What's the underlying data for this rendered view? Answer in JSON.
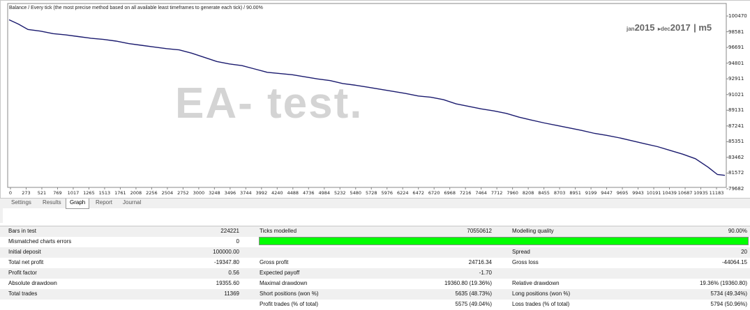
{
  "chart": {
    "title": "Balance / Every tick (the most precise method based on all available least timeframes to generate each tick) / 90.00%",
    "watermark": "EA-      test.",
    "period": {
      "from_month": "jan",
      "from_year": "2015",
      "to_month": "dec",
      "to_year": "2017",
      "tf": "m5"
    },
    "line_color": "#1a1a6e"
  },
  "chart_data": {
    "type": "line",
    "ylabel": "",
    "xlabel": "",
    "y_ticks": [
      "100470",
      "98581",
      "96691",
      "94801",
      "92911",
      "91021",
      "89131",
      "87241",
      "85351",
      "83462",
      "81572",
      "79682"
    ],
    "ylim": [
      79682,
      100470
    ],
    "x_ticks": [
      "0",
      "273",
      "521",
      "769",
      "1017",
      "1265",
      "1513",
      "1761",
      "2008",
      "2256",
      "2504",
      "2752",
      "3000",
      "3248",
      "3496",
      "3744",
      "3992",
      "4240",
      "4488",
      "4736",
      "4984",
      "5232",
      "5480",
      "5728",
      "5976",
      "6224",
      "6472",
      "6720",
      "6968",
      "7216",
      "7464",
      "7712",
      "7960",
      "8208",
      "8455",
      "8703",
      "8951",
      "9199",
      "9447",
      "9695",
      "9943",
      "10191",
      "10439",
      "10687",
      "10935",
      "11183"
    ],
    "xlim": [
      0,
      11369
    ],
    "series": [
      {
        "x": [
          0,
          150,
          300,
          500,
          700,
          900,
          1100,
          1300,
          1500,
          1700,
          1900,
          2100,
          2300,
          2500,
          2700,
          2900,
          3100,
          3300,
          3500,
          3700,
          3900,
          4100,
          4300,
          4500,
          4700,
          4900,
          5100,
          5300,
          5500,
          5700,
          5900,
          6100,
          6300,
          6500,
          6700,
          6900,
          7100,
          7300,
          7500,
          7700,
          7900,
          8100,
          8300,
          8500,
          8700,
          8900,
          9100,
          9300,
          9500,
          9700,
          9900,
          10100,
          10300,
          10500,
          10700,
          10900,
          11100,
          11250,
          11369
        ],
        "y": [
          100020,
          99500,
          98850,
          98650,
          98350,
          98200,
          98000,
          97800,
          97650,
          97450,
          97150,
          96950,
          96750,
          96550,
          96400,
          96000,
          95500,
          95000,
          94700,
          94500,
          94100,
          93700,
          93550,
          93400,
          93150,
          92900,
          92700,
          92350,
          92150,
          91900,
          91650,
          91400,
          91150,
          90850,
          90700,
          90400,
          89900,
          89600,
          89300,
          89050,
          88750,
          88300,
          87950,
          87600,
          87300,
          87000,
          86700,
          86350,
          86100,
          85800,
          85450,
          85100,
          84750,
          84300,
          83850,
          83300,
          82300,
          81400,
          81300
        ]
      }
    ]
  },
  "tabs": [
    {
      "label": "Settings",
      "active": false
    },
    {
      "label": "Results",
      "active": false
    },
    {
      "label": "Graph",
      "active": true
    },
    {
      "label": "Report",
      "active": false
    },
    {
      "label": "Journal",
      "active": false
    }
  ],
  "report": {
    "bars_label": "Bars in test",
    "bars_value": "224221",
    "ticks_label": "Ticks modelled",
    "ticks_value": "70550612",
    "quality_label": "Modelling quality",
    "quality_value": "90.00%",
    "mismatch_label": "Mismatched charts errors",
    "mismatch_value": "0",
    "quality_bar_color": "#00ff00",
    "deposit_label": "Initial deposit",
    "deposit_value": "100000.00",
    "spread_label": "Spread",
    "spread_value": "20",
    "net_label": "Total net profit",
    "net_value": "-19347.80",
    "gross_profit_label": "Gross profit",
    "gross_profit_value": "24716.34",
    "gross_loss_label": "Gross loss",
    "gross_loss_value": "-44064.15",
    "pf_label": "Profit factor",
    "pf_value": "0.56",
    "payoff_label": "Expected payoff",
    "payoff_value": "-1.70",
    "abs_dd_label": "Absolute drawdown",
    "abs_dd_value": "19355.60",
    "max_dd_label": "Maximal drawdown",
    "max_dd_value": "19360.80 (19.36%)",
    "rel_dd_label": "Relative drawdown",
    "rel_dd_value": "19.36% (19360.80)",
    "trades_label": "Total trades",
    "trades_value": "11369",
    "short_label": "Short positions (won %)",
    "short_value": "5635 (48.73%)",
    "long_label": "Long positions (won %)",
    "long_value": "5734 (49.34%)",
    "profit_trades_label": "Profit trades (% of total)",
    "profit_trades_value": "5575 (49.04%)",
    "loss_trades_label": "Loss trades (% of total)",
    "loss_trades_value": "5794 (50.96%)"
  }
}
